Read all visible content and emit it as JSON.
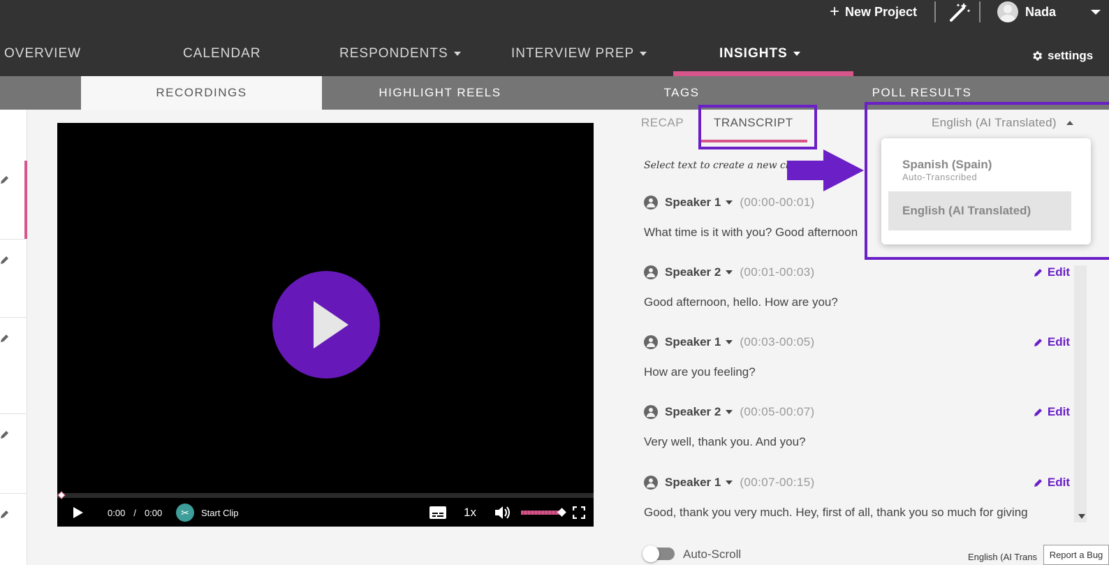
{
  "header": {
    "new_project_label": "New Project",
    "user_name": "Nada"
  },
  "nav": {
    "overview": "OVERVIEW",
    "calendar": "CALENDAR",
    "respondents": "RESPONDENTS",
    "interview_prep": "INTERVIEW PREP",
    "insights": "INSIGHTS",
    "settings": "settings"
  },
  "subnav": {
    "recordings": "RECORDINGS",
    "highlight_reels": "HIGHLIGHT REELS",
    "tags": "TAGS",
    "poll_results": "POLL RESULTS"
  },
  "player": {
    "current_time": "0:00",
    "separator": "/",
    "duration": "0:00",
    "start_clip": "Start Clip",
    "speed": "1x"
  },
  "panel": {
    "recap": "RECAP",
    "transcript": "TRANSCRIPT",
    "language_selected": "English (AI Translated)",
    "hint": "Select text to create a new clip"
  },
  "language_dropdown": {
    "options": [
      {
        "main": "Spanish (Spain)",
        "sub": "Auto-Transcribed"
      },
      {
        "main": "English (AI Translated)",
        "sub": ""
      }
    ]
  },
  "transcript": {
    "edit_label": "Edit",
    "segments": [
      {
        "speaker": "Speaker 1",
        "time": "(00:00-00:01)",
        "text": "What time is it with you? Good afternoon"
      },
      {
        "speaker": "Speaker 2",
        "time": "(00:01-00:03)",
        "text": "Good afternoon, hello. How are you?"
      },
      {
        "speaker": "Speaker 1",
        "time": "(00:03-00:05)",
        "text": "How are you feeling?"
      },
      {
        "speaker": "Speaker 2",
        "time": "(00:05-00:07)",
        "text": "Very well, thank you. And you?"
      },
      {
        "speaker": "Speaker 1",
        "time": "(00:07-00:15)",
        "text": "Good, thank you very much. Hey, first of all, thank you so much for giving"
      }
    ]
  },
  "footer": {
    "auto_scroll": "Auto-Scroll",
    "language_short": "English (AI Trans",
    "report_bug": "Report a Bug"
  },
  "colors": {
    "accent_purple": "#6a1fc7",
    "accent_pink": "#d6558a",
    "topbar_bg": "#333333"
  }
}
